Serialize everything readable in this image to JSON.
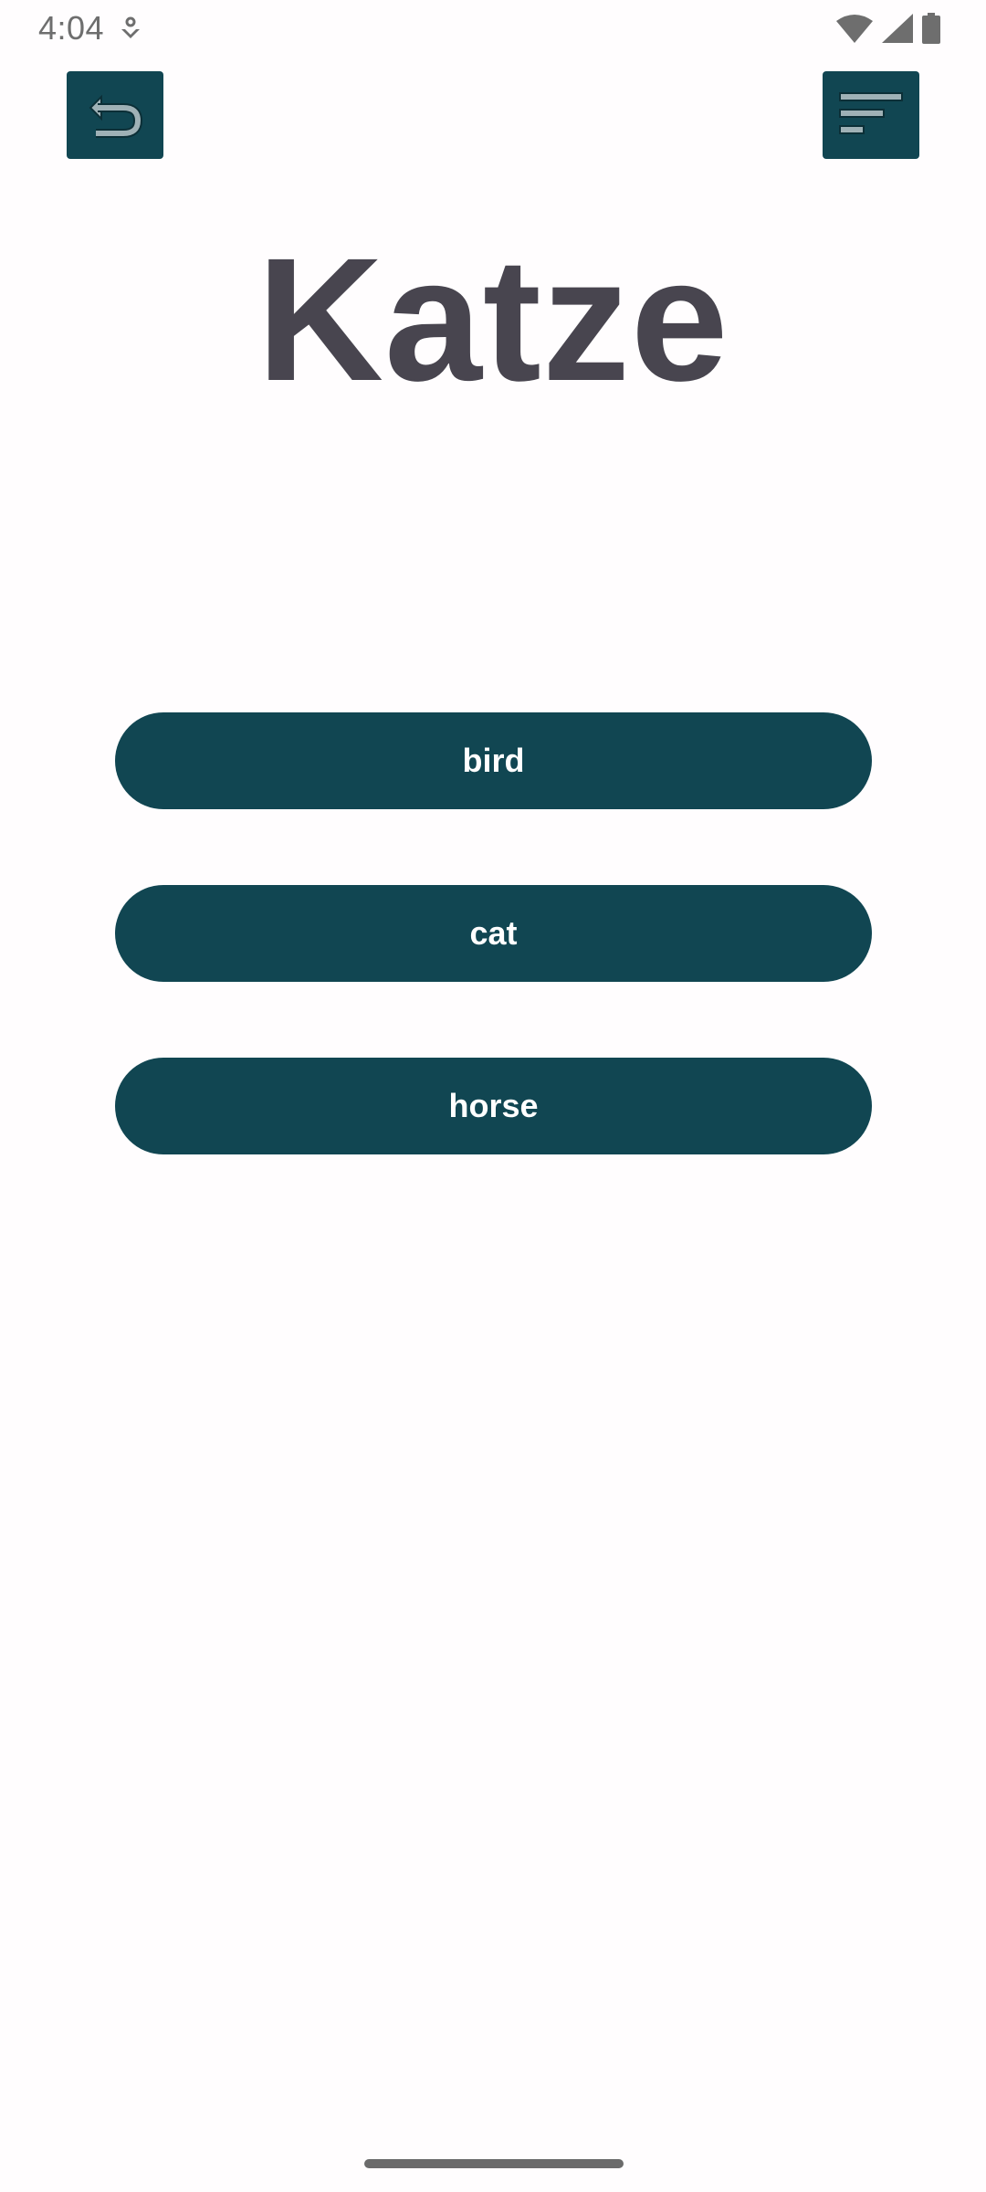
{
  "status_bar": {
    "time": "4:04",
    "icons": [
      "notification-icon",
      "wifi-icon",
      "cell-signal-icon",
      "battery-icon"
    ]
  },
  "toolbar": {
    "back_icon": "undo-arrow-icon",
    "menu_icon": "sort-lines-icon"
  },
  "quiz": {
    "word": "Katze",
    "answers": [
      {
        "label": "bird"
      },
      {
        "label": "cat"
      },
      {
        "label": "horse"
      }
    ]
  },
  "colors": {
    "accent": "#114652",
    "title": "#48454f",
    "background": "#fffdfe",
    "icon_tint": "#9fb1b6"
  }
}
